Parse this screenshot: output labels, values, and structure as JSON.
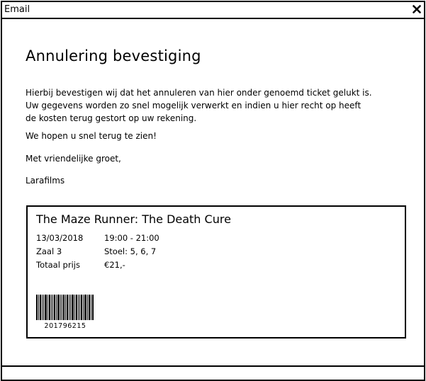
{
  "window": {
    "title": "Email",
    "close_icon": "close-icon"
  },
  "email": {
    "heading": "Annulering bevestiging",
    "intro_lines": [
      "Hierbij bevestigen wij dat het annuleren van hier onder genoemd ticket gelukt is.",
      "Uw gegevens worden zo snel mogelijk verwerkt en indien u hier recht op heeft",
      "de kosten terug gestort op uw rekening."
    ],
    "hope": "We hopen u snel terug te zien!",
    "greeting": "Met vriendelijke groet,",
    "signature": "Larafilms"
  },
  "ticket": {
    "movie_title": "The Maze Runner: The Death Cure",
    "date": "13/03/2018",
    "time": "19:00 - 21:00",
    "hall": "Zaal 3",
    "seats": "Stoel: 5, 6, 7",
    "total_label": "Totaal prijs",
    "total_value": "€21,-",
    "barcode_number": "201796215",
    "barcode_icon": "barcode-icon"
  }
}
